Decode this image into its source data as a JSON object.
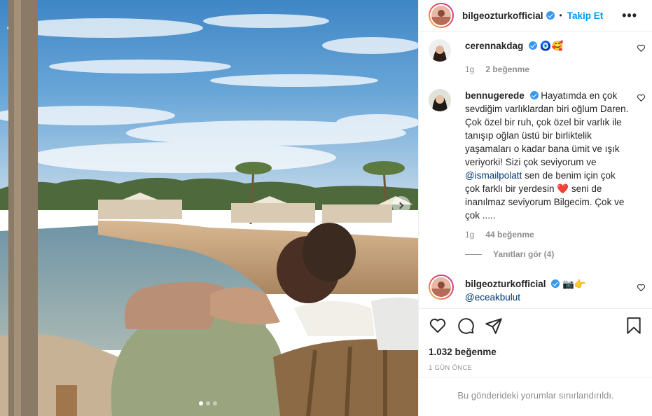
{
  "post": {
    "author": "bilgeozturkofficial",
    "separator": "•",
    "follow_label": "Takip Et",
    "more_label": "•••"
  },
  "comments": [
    {
      "username": "cerennakdag",
      "text": "🧿🥰",
      "time": "1g",
      "likes": "2 beğenme",
      "verified": true
    },
    {
      "username": "bennugerede",
      "text_1": "Hayatımda en çok sevdiğim varlıklardan biri oğlum Daren. Çok özel bir ruh, çok özel bir varlık ile tanışıp oğlan üstü bir birliktelik yaşamaları o kadar bana ümit ve ışık veriyorki! Sizi çok seviyorum ve ",
      "mention": "@ismailpolatt",
      "text_2": " sen de benim için çok çok farklı bir yerdesin ",
      "emoji": "❤️",
      "text_3": " seni de inanılmaz seviyorum Bilgecim. Çok ve çok .....",
      "time": "1g",
      "likes": "44 beğenme",
      "view_replies": "Yanıtları gör (4)",
      "verified": true
    },
    {
      "username": "bilgeozturkofficial",
      "text": "📷👉",
      "mention": "@eceakbulut",
      "verified": true
    }
  ],
  "actions": {
    "like_icon": "heart-icon",
    "comment_icon": "comment-icon",
    "share_icon": "share-icon",
    "save_icon": "bookmark-icon"
  },
  "likes_total": "1.032 beğenme",
  "posted_ago": "1 GÜN ÖNCE",
  "comments_limited": "Bu gönderideki yorumlar sınırlandırıldı.",
  "carousel": {
    "current": 1,
    "total": 3
  },
  "colors": {
    "link": "#0095f6",
    "verified": "#3897f0",
    "muted": "#8e8e8e",
    "mention": "#00376b"
  }
}
